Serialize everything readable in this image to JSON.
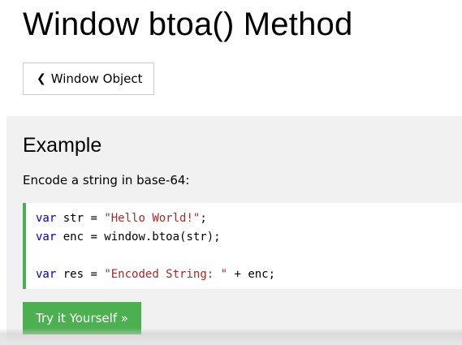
{
  "page": {
    "title": "Window btoa() Method"
  },
  "nav": {
    "back_chevron": "❮",
    "back_label": "Window Object"
  },
  "example": {
    "heading": "Example",
    "description": "Encode a string in base-64:",
    "code": {
      "line1": {
        "kw": "var",
        "plain": " str = ",
        "str": "\"Hello World!\"",
        "end": ";"
      },
      "line2": {
        "kw": "var",
        "plain": " enc = window.btoa(str);"
      },
      "line4": {
        "kw": "var",
        "plain": " res = ",
        "str": "\"Encoded String: \"",
        "end": " + enc;"
      }
    },
    "try_label": "Try it Yourself »"
  },
  "colors": {
    "accent": "#4caf50",
    "panel_bg": "#f1f1f1",
    "keyword": "#0000cd",
    "string": "#a52a2a"
  }
}
